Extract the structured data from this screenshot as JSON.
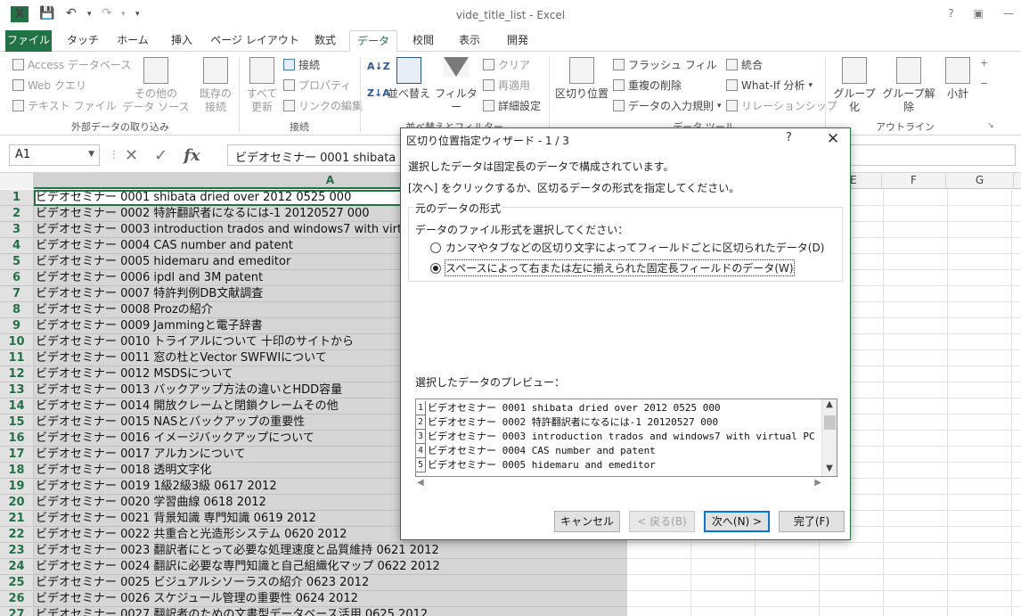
{
  "window": {
    "title": "vide_title_list - Excel",
    "help": "?",
    "app_icon": "excel-icon"
  },
  "tabs": [
    "ファイル",
    "タッチ",
    "ホーム",
    "挿入",
    "ページ レイアウト",
    "数式",
    "データ",
    "校閲",
    "表示",
    "開発"
  ],
  "active_tab": "データ",
  "ribbon": {
    "get_external": {
      "access": "Access データベース",
      "web": "Web クエリ",
      "text": "テキスト ファイル",
      "other": "その他の",
      "other2": "データ ソース",
      "existing": "既存の",
      "existing2": "接続",
      "group": "外部データの取り込み"
    },
    "connections": {
      "refresh": "すべて",
      "refresh2": "更新",
      "connect": "接続",
      "properties": "プロパティ",
      "edit_links": "リンクの編集",
      "group": "接続"
    },
    "sort_filter": {
      "sort": "並べ替え",
      "filter": "フィルター",
      "clear": "クリア",
      "reapply": "再適用",
      "advanced": "詳細設定",
      "group": "並べ替えとフィルター"
    },
    "data_tools": {
      "text_to_columns": "区切り位置",
      "flash_fill": "フラッシュ フィル",
      "remove_dup": "重複の削除",
      "validation": "データの入力規則",
      "consolidate": "統合",
      "whatif": "What-If 分析",
      "relationship": "リレーションシップ",
      "group": "データ ツール"
    },
    "outline": {
      "group_btn": "グループ化",
      "ungroup": "グループ解除",
      "subtotal": "小計",
      "group": "アウトライン"
    }
  },
  "formula_bar": {
    "name_box": "A1",
    "content": "ビデオセミナー 0001  shibata"
  },
  "columns": [
    "A",
    "E",
    "F",
    "G"
  ],
  "rows": [
    "ビデオセミナー 0001  shibata dried over 2012 0525 000",
    "ビデオセミナー 0002   特許翻訳者になるには-1   20120527 000",
    "ビデオセミナー 0003  introduction trados and windows7 with virtual PC",
    "ビデオセミナー 0004 CAS number and patent",
    "ビデオセミナー 0005  hidemaru and emeditor",
    "ビデオセミナー 0006  ipdl and 3M patent",
    "ビデオセミナー 0007 特許判例DB文献調査",
    "ビデオセミナー 0008  Prozの紹介",
    "ビデオセミナー 0009  Jammingと電子辞書",
    "ビデオセミナー 0010 トライアルについて   十印のサイトから",
    "ビデオセミナー 0011  窓の杜とVector SWFWIについて",
    "ビデオセミナー 0012  MSDSについて",
    "ビデオセミナー 0013  バックアップ方法の違いとHDD容量",
    "ビデオセミナー 0014  開放クレームと閉鎖クレームその他",
    "ビデオセミナー 0015  NASとバックアップの重要性",
    "ビデオセミナー 0016  イメージバックアップについて",
    "ビデオセミナー 0017  アルカンについて",
    "ビデオセミナー 0018  透明文字化",
    "ビデオセミナー 0019  1級2級3級 0617 2012",
    "ビデオセミナー 0020  学習曲線 0618 2012",
    "ビデオセミナー 0021  背景知識   専門知識 0619 2012",
    "ビデオセミナー 0022  共重合と光造形システム    0620 2012",
    "ビデオセミナー 0023  翻訳者にとって必要な処理速度と品質維持 0621 2012",
    "ビデオセミナー 0024  翻訳に必要な専門知識と自己組織化マップ   0622 2012",
    "ビデオセミナー 0025  ビジュアルシソーラスの紹介   0623 2012",
    "ビデオセミナー 0026  スケジュール管理の重要性   0624 2012",
    "ビデオセミナー 0027  翻訳者のための文書型データベース活用  0625 2012"
  ],
  "dialog": {
    "title": "区切り位置指定ウィザード - 1 / 3",
    "help": "?",
    "line1": "選択したデータは固定長のデータで構成されています。",
    "line2": "[次へ] をクリックするか、区切るデータの形式を指定してください。",
    "legend": "元のデータの形式",
    "prompt": "データのファイル形式を選択してください：",
    "option1": "カンマやタブなどの区切り文字によってフィールドごとに区切られたデータ(D)",
    "option2": "スペースによって右または左に揃えられた固定長フィールドのデータ(W)",
    "selected_option": 2,
    "preview_label": "選択したデータのプレビュー：",
    "preview": [
      {
        "n": "1",
        "t": "ビデオセミナー 0001 shibata dried over 2012 0525 000"
      },
      {
        "n": "2",
        "t": "ビデオセミナー 0002  特許翻訳者になるには-1  20120527 000"
      },
      {
        "n": "3",
        "t": "ビデオセミナー 0003 introduction trados and windows7 with virtual PC"
      },
      {
        "n": "4",
        "t": "ビデオセミナー 0004 CAS number and patent"
      },
      {
        "n": "5",
        "t": "ビデオセミナー 0005 hidemaru and emeditor"
      }
    ],
    "buttons": {
      "cancel": "キャンセル",
      "back": "< 戻る(B)",
      "next": "次へ(N) >",
      "finish": "完了(F)"
    }
  }
}
